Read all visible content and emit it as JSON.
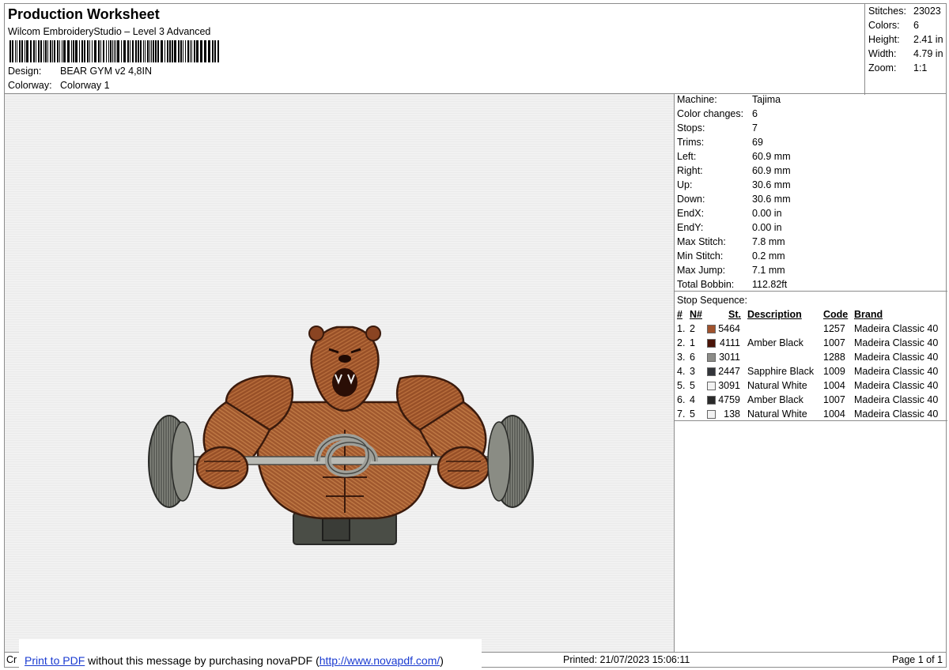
{
  "header": {
    "title": "Production Worksheet",
    "subtitle": "Wilcom EmbroideryStudio – Level 3 Advanced",
    "design_label": "Design:",
    "design_value": "BEAR GYM v2 4,8IN",
    "colorway_label": "Colorway:",
    "colorway_value": "Colorway 1"
  },
  "summary": [
    {
      "k": "Stitches:",
      "v": "23023"
    },
    {
      "k": "Colors:",
      "v": "6"
    },
    {
      "k": "Height:",
      "v": "2.41 in"
    },
    {
      "k": "Width:",
      "v": "4.79 in"
    },
    {
      "k": "Zoom:",
      "v": "1:1"
    }
  ],
  "machine_info": [
    {
      "k": "Machine:",
      "v": "Tajima"
    },
    {
      "k": "Color changes:",
      "v": "6"
    },
    {
      "k": "Stops:",
      "v": "7"
    },
    {
      "k": "Trims:",
      "v": "69"
    },
    {
      "k": "Left:",
      "v": "60.9 mm"
    },
    {
      "k": "Right:",
      "v": "60.9 mm"
    },
    {
      "k": "Up:",
      "v": "30.6 mm"
    },
    {
      "k": "Down:",
      "v": "30.6 mm"
    },
    {
      "k": "EndX:",
      "v": "0.00 in"
    },
    {
      "k": "EndY:",
      "v": "0.00 in"
    },
    {
      "k": "Max Stitch:",
      "v": "7.8 mm"
    },
    {
      "k": "Min Stitch:",
      "v": "0.2 mm"
    },
    {
      "k": "Max Jump:",
      "v": "7.1 mm"
    },
    {
      "k": "Total Bobbin:",
      "v": "112.82ft"
    }
  ],
  "stop_sequence": {
    "label": "Stop Sequence:",
    "headers": {
      "num": "#",
      "n": "N#",
      "st": "St.",
      "desc": "Description",
      "code": "Code",
      "brand": "Brand"
    },
    "rows": [
      {
        "num": "1.",
        "n": "2",
        "color": "#a0522d",
        "st": "5464",
        "desc": "",
        "code": "1257",
        "brand": "Madeira Classic 40"
      },
      {
        "num": "2.",
        "n": "1",
        "color": "#4a1408",
        "st": "4111",
        "desc": "Amber Black",
        "code": "1007",
        "brand": "Madeira Classic 40"
      },
      {
        "num": "3.",
        "n": "6",
        "color": "#8c8c88",
        "st": "3011",
        "desc": "",
        "code": "1288",
        "brand": "Madeira Classic 40"
      },
      {
        "num": "4.",
        "n": "3",
        "color": "#33353a",
        "st": "2447",
        "desc": "Sapphire Black",
        "code": "1009",
        "brand": "Madeira Classic 40"
      },
      {
        "num": "5.",
        "n": "5",
        "color": "#f2f2f2",
        "st": "3091",
        "desc": "Natural White",
        "code": "1004",
        "brand": "Madeira Classic 40"
      },
      {
        "num": "6.",
        "n": "4",
        "color": "#2a2a2a",
        "st": "4759",
        "desc": "Amber Black",
        "code": "1007",
        "brand": "Madeira Classic 40"
      },
      {
        "num": "7.",
        "n": "5",
        "color": "#f2f2f2",
        "st": "138",
        "desc": "Natural White",
        "code": "1004",
        "brand": "Madeira Classic 40"
      }
    ]
  },
  "footer": {
    "left": "Cr",
    "nova_link1": "Print to PDF",
    "nova_mid": " without this message by purchasing novaPDF (",
    "nova_link2": "http://www.novapdf.com/",
    "nova_end": ")",
    "printed": "Printed: 21/07/2023 15:06:11",
    "page": "Page 1 of 1"
  }
}
